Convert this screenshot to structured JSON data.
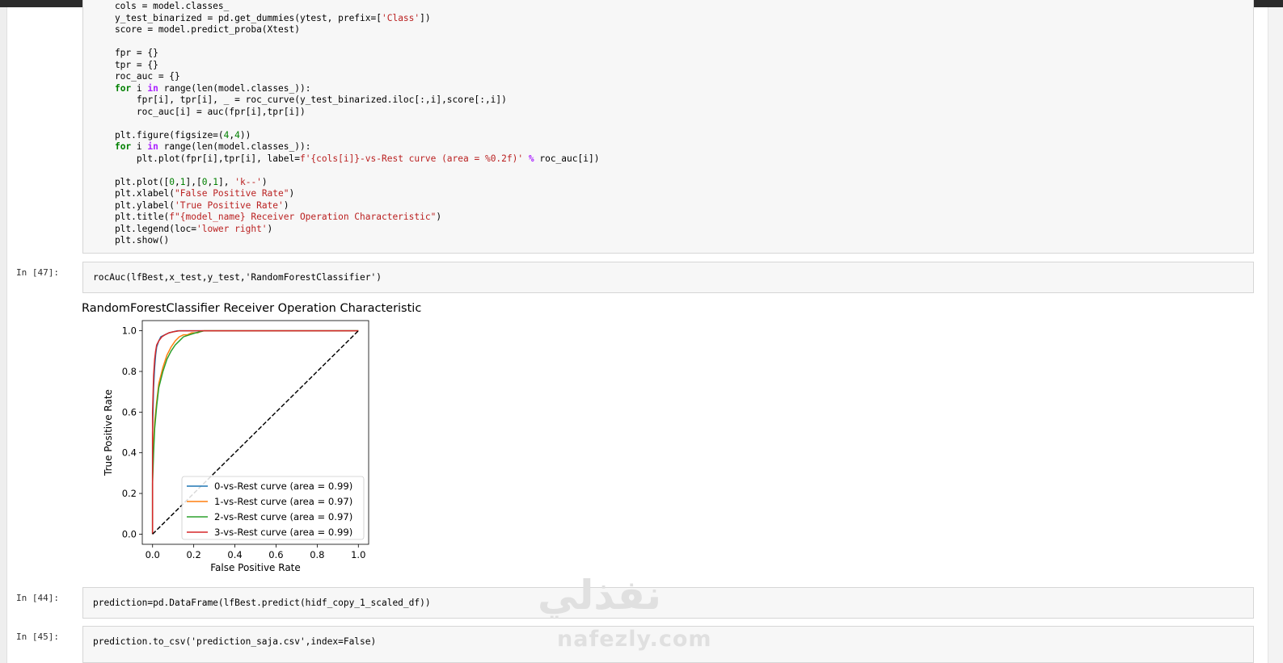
{
  "cells": {
    "function_def": {
      "lines": [
        "    cols = model.classes_",
        "    y_test_binarized = pd.get_dummies(ytest, prefix=['Class'])",
        "    score = model.predict_proba(Xtest)",
        "",
        "    fpr = {}",
        "    tpr = {}",
        "    roc_auc = {}",
        "    for i in range(len(model.classes_)):",
        "        fpr[i], tpr[i], _ = roc_curve(y_test_binarized.iloc[:,i],score[:,i])",
        "        roc_auc[i] = auc(fpr[i],tpr[i])",
        "",
        "    plt.figure(figsize=(4,4))",
        "    for i in range(len(model.classes_)):",
        "        plt.plot(fpr[i],tpr[i], label=f'{cols[i]}-vs-Rest curve (area = %0.2f)' % roc_auc[i])",
        "",
        "    plt.plot([0,1],[0,1], 'k--')",
        "    plt.xlabel(\"False Positive Rate\")",
        "    plt.ylabel('True Positive Rate')",
        "    plt.title(f\"{model_name} Receiver Operation Characteristic\")",
        "    plt.legend(loc='lower right')",
        "    plt.show()"
      ]
    },
    "cell47": {
      "prompt": "In [47]:",
      "code": "rocAuc(lfBest,x_test,y_test,'RandomForestClassifier')"
    },
    "cell44": {
      "prompt": "In [44]:",
      "code": "prediction=pd.DataFrame(lfBest.predict(hidf_copy_1_scaled_df))"
    },
    "cell45": {
      "prompt": "In [45]:",
      "code": "prediction.to_csv('prediction_saja.csv',index=False)"
    }
  },
  "watermark": {
    "arabic": "نفذلي",
    "latin": "nafezly.com"
  },
  "chart_data": {
    "type": "line",
    "title": "RandomForestClassifier Receiver Operation Characteristic",
    "xlabel": "False Positive Rate",
    "ylabel": "True Positive Rate",
    "xlim": [
      -0.05,
      1.05
    ],
    "ylim": [
      -0.05,
      1.05
    ],
    "xticks": [
      "0.0",
      "0.2",
      "0.4",
      "0.6",
      "0.8",
      "1.0"
    ],
    "yticks": [
      "0.0",
      "0.2",
      "0.4",
      "0.6",
      "0.8",
      "1.0"
    ],
    "grid": false,
    "legend_position": "lower-right",
    "series": [
      {
        "name": "0-vs-Rest curve (area = 0.99)",
        "color": "#1f77b4",
        "x": [
          0,
          0,
          0.005,
          0.01,
          0.015,
          0.02,
          0.03,
          0.04,
          0.06,
          0.08,
          0.1,
          0.12,
          1.0
        ],
        "y": [
          0,
          0.5,
          0.72,
          0.82,
          0.88,
          0.92,
          0.95,
          0.97,
          0.98,
          0.99,
          0.995,
          1.0,
          1.0
        ]
      },
      {
        "name": "1-vs-Rest curve (area = 0.97)",
        "color": "#ff7f0e",
        "x": [
          0,
          0,
          0.005,
          0.01,
          0.02,
          0.03,
          0.05,
          0.07,
          0.09,
          0.11,
          0.13,
          0.15,
          0.17,
          0.19,
          0.22,
          0.24,
          1.0
        ],
        "y": [
          0,
          0.3,
          0.45,
          0.55,
          0.65,
          0.74,
          0.82,
          0.88,
          0.92,
          0.95,
          0.97,
          0.98,
          0.98,
          0.99,
          0.99,
          1.0,
          1.0
        ]
      },
      {
        "name": "2-vs-Rest curve (area = 0.97)",
        "color": "#2ca02c",
        "x": [
          0,
          0,
          0.005,
          0.01,
          0.02,
          0.03,
          0.05,
          0.07,
          0.09,
          0.11,
          0.13,
          0.15,
          0.18,
          0.21,
          0.25,
          1.0
        ],
        "y": [
          0,
          0.25,
          0.4,
          0.52,
          0.63,
          0.72,
          0.8,
          0.86,
          0.9,
          0.93,
          0.95,
          0.97,
          0.98,
          0.99,
          1.0,
          1.0
        ]
      },
      {
        "name": "3-vs-Rest curve (area = 0.99)",
        "color": "#d62728",
        "x": [
          0,
          0,
          0.005,
          0.01,
          0.015,
          0.02,
          0.03,
          0.045,
          0.06,
          0.08,
          0.1,
          0.13,
          1.0
        ],
        "y": [
          0,
          0.6,
          0.78,
          0.86,
          0.9,
          0.93,
          0.95,
          0.97,
          0.98,
          0.99,
          0.995,
          1.0,
          1.0
        ]
      },
      {
        "name": "",
        "color": "#000000",
        "dashed": true,
        "x": [
          0,
          1
        ],
        "y": [
          0,
          1
        ]
      }
    ]
  }
}
